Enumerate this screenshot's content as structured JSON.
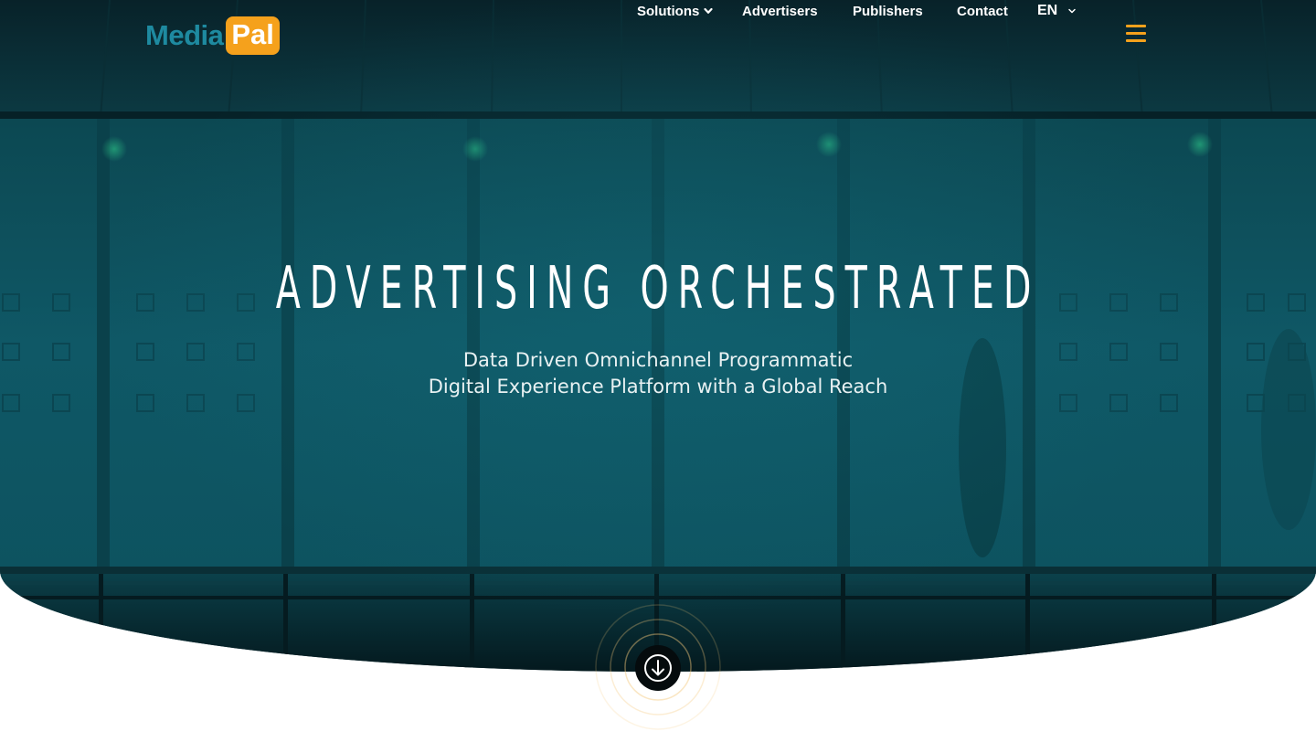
{
  "brand": {
    "logo_part1": "Media",
    "logo_part2": "Pal",
    "accent_color": "#f5a11c",
    "logo_blue": "#1e8aa0"
  },
  "nav": {
    "items": [
      {
        "label": "Solutions",
        "has_dropdown": true
      },
      {
        "label": "Advertisers",
        "has_dropdown": false
      },
      {
        "label": "Publishers",
        "has_dropdown": false
      },
      {
        "label": "Contact",
        "has_dropdown": false
      }
    ],
    "language": {
      "selected": "EN",
      "icon": "chevron-down-icon"
    },
    "menu_icon": "hamburger-icon"
  },
  "hero": {
    "headline": "ADVERTISING ORCHESTRATED",
    "subline_1": "Data Driven Omnichannel Programmatic",
    "subline_2": "Digital Experience Platform with a Global Reach",
    "scroll_icon": "arrow-down-circle-icon",
    "background_color": "#0e5662"
  }
}
